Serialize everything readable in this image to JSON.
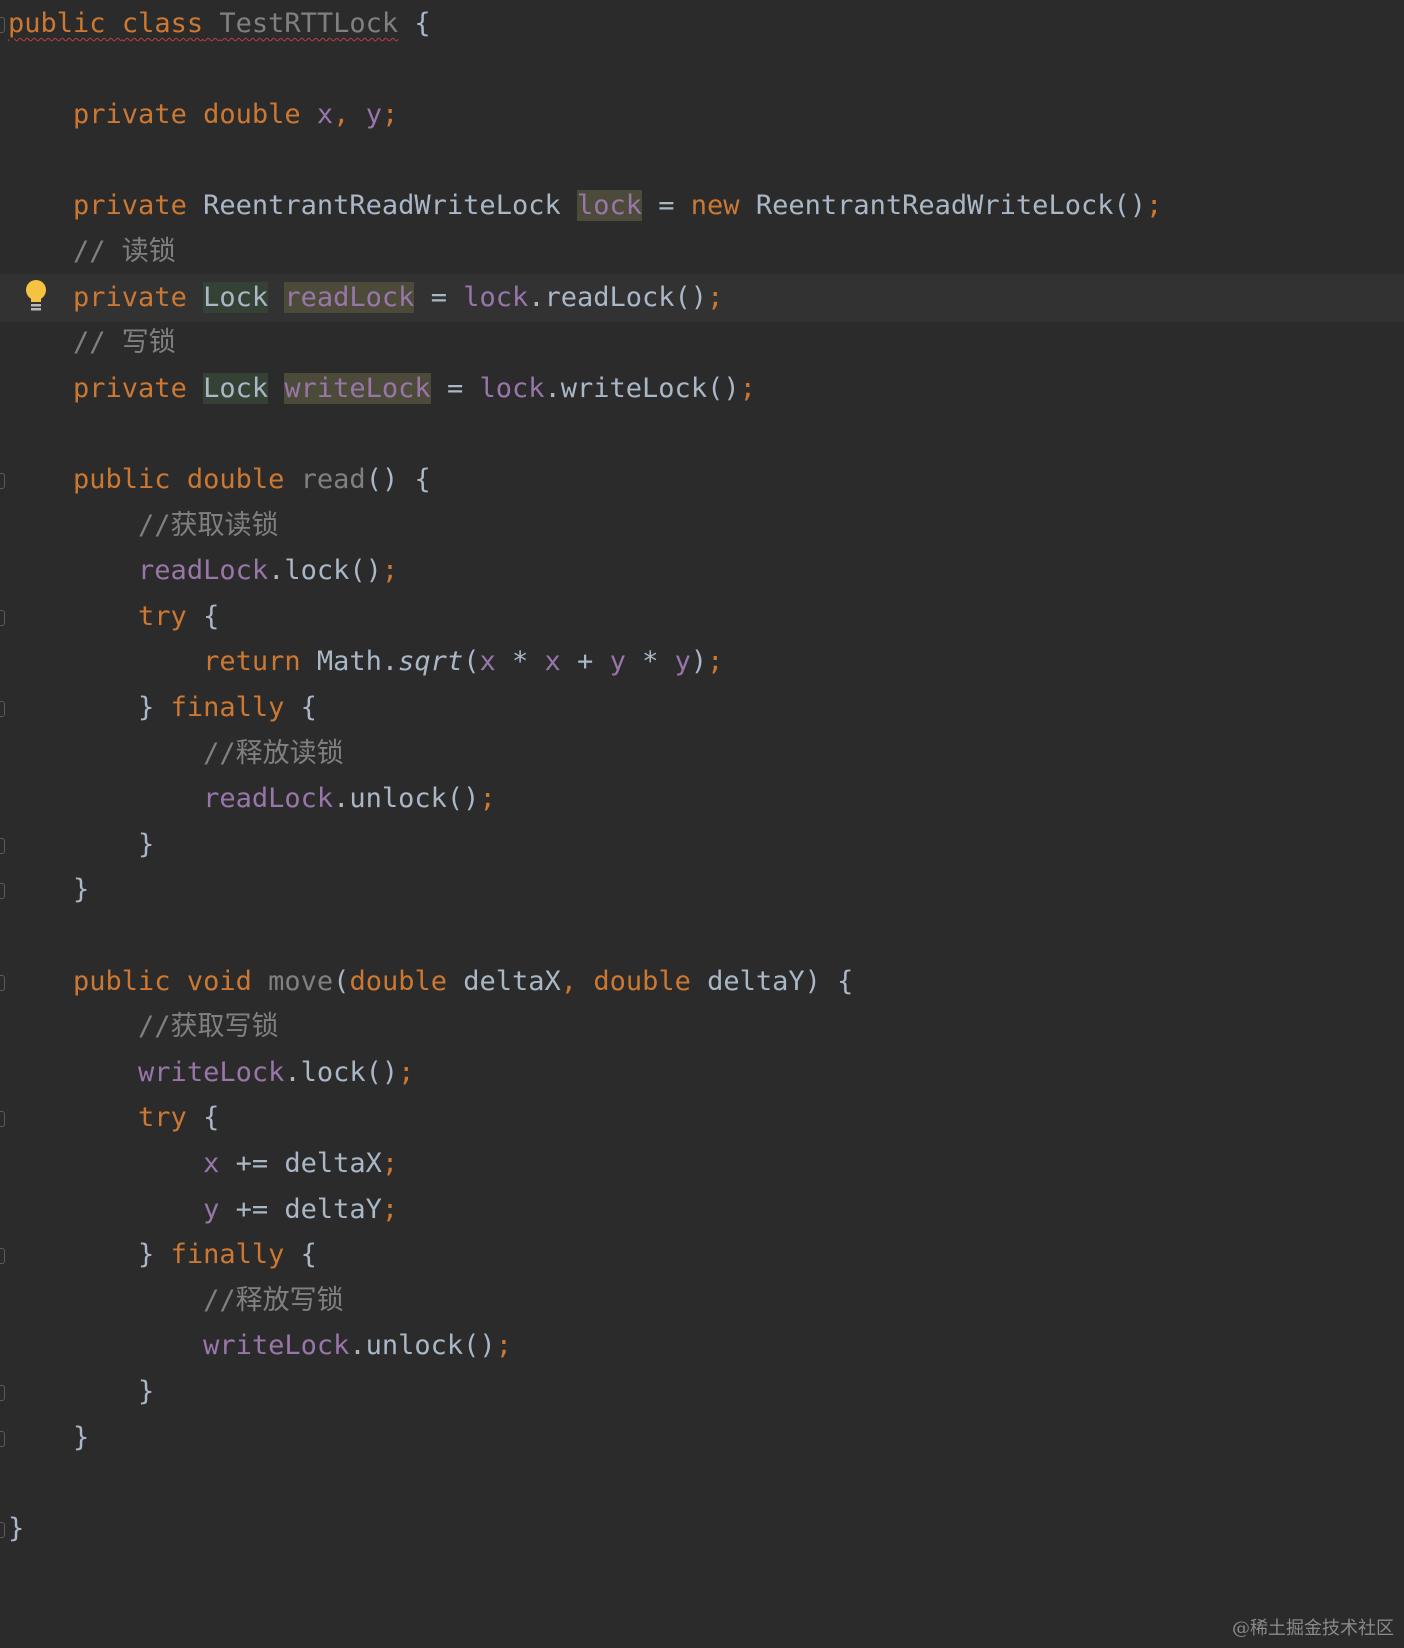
{
  "editor": {
    "language": "Java",
    "lines": [
      [
        {
          "t": "public",
          "k": "kw squiggle"
        },
        {
          "t": " ",
          "k": "punc squiggle"
        },
        {
          "t": "class",
          "k": "kw squiggle"
        },
        {
          "t": " ",
          "k": "punc squiggle"
        },
        {
          "t": "TestRTTLock",
          "k": "unused squiggle"
        },
        {
          "t": " {",
          "k": "punc"
        }
      ],
      [],
      [
        {
          "t": "    "
        },
        {
          "t": "private",
          "k": "kw"
        },
        {
          "t": " "
        },
        {
          "t": "double",
          "k": "kw"
        },
        {
          "t": " "
        },
        {
          "t": "x",
          "k": "fld"
        },
        {
          "t": ",",
          "k": "semi"
        },
        {
          "t": " "
        },
        {
          "t": "y",
          "k": "fld"
        },
        {
          "t": ";",
          "k": "semi"
        }
      ],
      [],
      [
        {
          "t": "    "
        },
        {
          "t": "private",
          "k": "kw"
        },
        {
          "t": " "
        },
        {
          "t": "ReentrantReadWriteLock",
          "k": "typ"
        },
        {
          "t": " "
        },
        {
          "t": "lock",
          "k": "fld hl-field"
        },
        {
          "t": " = "
        },
        {
          "t": "new",
          "k": "kw"
        },
        {
          "t": " "
        },
        {
          "t": "ReentrantReadWriteLock",
          "k": "typ"
        },
        {
          "t": "()"
        },
        {
          "t": ";",
          "k": "semi"
        }
      ],
      [
        {
          "t": "    "
        },
        {
          "t": "// 读锁",
          "k": "cmt"
        }
      ],
      [
        {
          "t": "    "
        },
        {
          "t": "private",
          "k": "kw"
        },
        {
          "t": " "
        },
        {
          "t": "Lock",
          "k": "typ hl-type"
        },
        {
          "t": " "
        },
        {
          "t": "readLock",
          "k": "fld hl-field"
        },
        {
          "t": " = "
        },
        {
          "t": "lock",
          "k": "fld"
        },
        {
          "t": ".readLock()"
        },
        {
          "t": ";",
          "k": "semi"
        }
      ],
      [
        {
          "t": "    "
        },
        {
          "t": "// 写锁",
          "k": "cmt"
        }
      ],
      [
        {
          "t": "    "
        },
        {
          "t": "private",
          "k": "kw"
        },
        {
          "t": " "
        },
        {
          "t": "Lock",
          "k": "typ hl-type"
        },
        {
          "t": " "
        },
        {
          "t": "writeLock",
          "k": "fld hl-field"
        },
        {
          "t": " = "
        },
        {
          "t": "lock",
          "k": "fld"
        },
        {
          "t": ".writeLock()"
        },
        {
          "t": ";",
          "k": "semi"
        }
      ],
      [],
      [
        {
          "t": "    "
        },
        {
          "t": "public",
          "k": "kw"
        },
        {
          "t": " "
        },
        {
          "t": "double",
          "k": "kw"
        },
        {
          "t": " "
        },
        {
          "t": "read",
          "k": "unused"
        },
        {
          "t": "() {"
        }
      ],
      [
        {
          "t": "        "
        },
        {
          "t": "//获取读锁",
          "k": "cmt"
        }
      ],
      [
        {
          "t": "        "
        },
        {
          "t": "readLock",
          "k": "fld"
        },
        {
          "t": ".lock()"
        },
        {
          "t": ";",
          "k": "semi"
        }
      ],
      [
        {
          "t": "        "
        },
        {
          "t": "try",
          "k": "kw"
        },
        {
          "t": " {"
        }
      ],
      [
        {
          "t": "            "
        },
        {
          "t": "return",
          "k": "kw"
        },
        {
          "t": " Math."
        },
        {
          "t": "sqrt",
          "k": "typ italic"
        },
        {
          "t": "("
        },
        {
          "t": "x",
          "k": "fld"
        },
        {
          "t": " * "
        },
        {
          "t": "x",
          "k": "fld"
        },
        {
          "t": " + "
        },
        {
          "t": "y",
          "k": "fld"
        },
        {
          "t": " * "
        },
        {
          "t": "y",
          "k": "fld"
        },
        {
          "t": ")"
        },
        {
          "t": ";",
          "k": "semi"
        }
      ],
      [
        {
          "t": "        } "
        },
        {
          "t": "finally",
          "k": "kw"
        },
        {
          "t": " {"
        }
      ],
      [
        {
          "t": "            "
        },
        {
          "t": "//释放读锁",
          "k": "cmt"
        }
      ],
      [
        {
          "t": "            "
        },
        {
          "t": "readLock",
          "k": "fld"
        },
        {
          "t": ".unlock()"
        },
        {
          "t": ";",
          "k": "semi"
        }
      ],
      [
        {
          "t": "        }"
        }
      ],
      [
        {
          "t": "    }"
        }
      ],
      [],
      [
        {
          "t": "    "
        },
        {
          "t": "public",
          "k": "kw"
        },
        {
          "t": " "
        },
        {
          "t": "void",
          "k": "kw"
        },
        {
          "t": " "
        },
        {
          "t": "move",
          "k": "unused"
        },
        {
          "t": "("
        },
        {
          "t": "double",
          "k": "kw"
        },
        {
          "t": " deltaX"
        },
        {
          "t": ",",
          "k": "semi"
        },
        {
          "t": " "
        },
        {
          "t": "double",
          "k": "kw"
        },
        {
          "t": " deltaY) {"
        }
      ],
      [
        {
          "t": "        "
        },
        {
          "t": "//获取写锁",
          "k": "cmt"
        }
      ],
      [
        {
          "t": "        "
        },
        {
          "t": "writeLock",
          "k": "fld"
        },
        {
          "t": ".lock()"
        },
        {
          "t": ";",
          "k": "semi"
        }
      ],
      [
        {
          "t": "        "
        },
        {
          "t": "try",
          "k": "kw"
        },
        {
          "t": " {"
        }
      ],
      [
        {
          "t": "            "
        },
        {
          "t": "x",
          "k": "fld"
        },
        {
          "t": " += deltaX"
        },
        {
          "t": ";",
          "k": "semi"
        }
      ],
      [
        {
          "t": "            "
        },
        {
          "t": "y",
          "k": "fld"
        },
        {
          "t": " += deltaY"
        },
        {
          "t": ";",
          "k": "semi"
        }
      ],
      [
        {
          "t": "        } "
        },
        {
          "t": "finally",
          "k": "kw"
        },
        {
          "t": " {"
        }
      ],
      [
        {
          "t": "            "
        },
        {
          "t": "//释放写锁",
          "k": "cmt"
        }
      ],
      [
        {
          "t": "            "
        },
        {
          "t": "writeLock",
          "k": "fld"
        },
        {
          "t": ".unlock()"
        },
        {
          "t": ";",
          "k": "semi"
        }
      ],
      [
        {
          "t": "        }"
        }
      ],
      [
        {
          "t": "    }"
        }
      ],
      [],
      [
        {
          "t": "}"
        }
      ]
    ],
    "current_line_index": 6,
    "intention_bulb_line_index": 6,
    "fold_marker_line_indices": [
      0,
      10,
      13,
      15,
      18,
      19,
      21,
      24,
      27,
      30,
      31,
      33
    ]
  },
  "icons": {
    "intention_bulb": "lightbulb-icon",
    "fold_marker": "fold-marker-icon"
  },
  "colors": {
    "background": "#2b2b2b",
    "current_line": "#323232",
    "keyword": "#cc7832",
    "field": "#9876aa",
    "text": "#a9b7c6",
    "comment": "#808080",
    "bulb": "#f5c242"
  },
  "watermark": {
    "text": "@稀土掘金技术社区"
  }
}
